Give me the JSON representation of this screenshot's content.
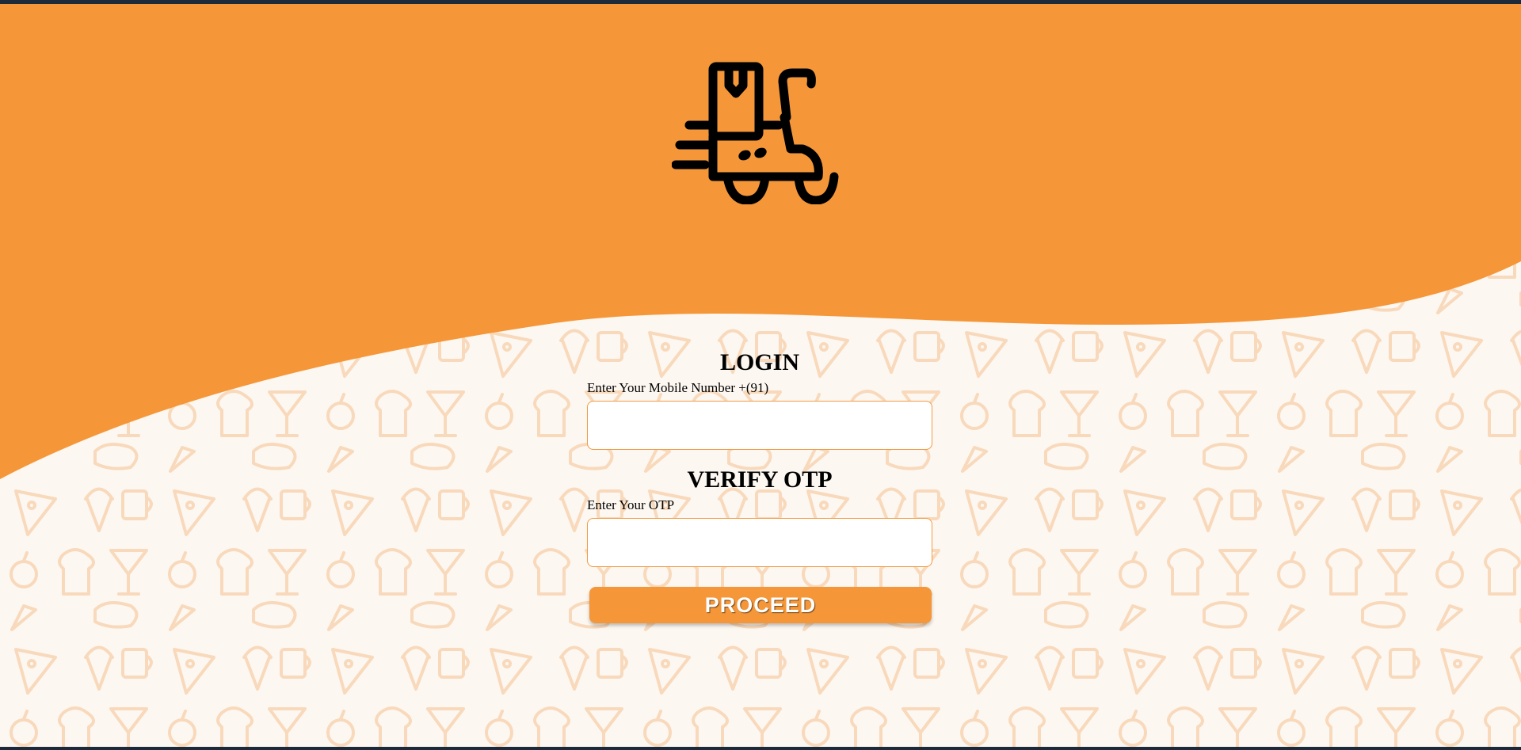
{
  "colors": {
    "brand_orange": "#f59738",
    "background": "#fdf7f1",
    "pattern": "#f8d9bb",
    "input_border": "#f29a42",
    "button_text": "#ffffff"
  },
  "logo": {
    "icon": "delivery-scooter-icon"
  },
  "login": {
    "heading": "LOGIN",
    "mobile_label": "Enter Your Mobile Number +(91)",
    "mobile_value": "",
    "mobile_placeholder": ""
  },
  "verify": {
    "heading": "VERIFY OTP",
    "otp_label": "Enter Your OTP",
    "otp_value": "",
    "otp_placeholder": ""
  },
  "actions": {
    "proceed_label": "PROCEED"
  }
}
